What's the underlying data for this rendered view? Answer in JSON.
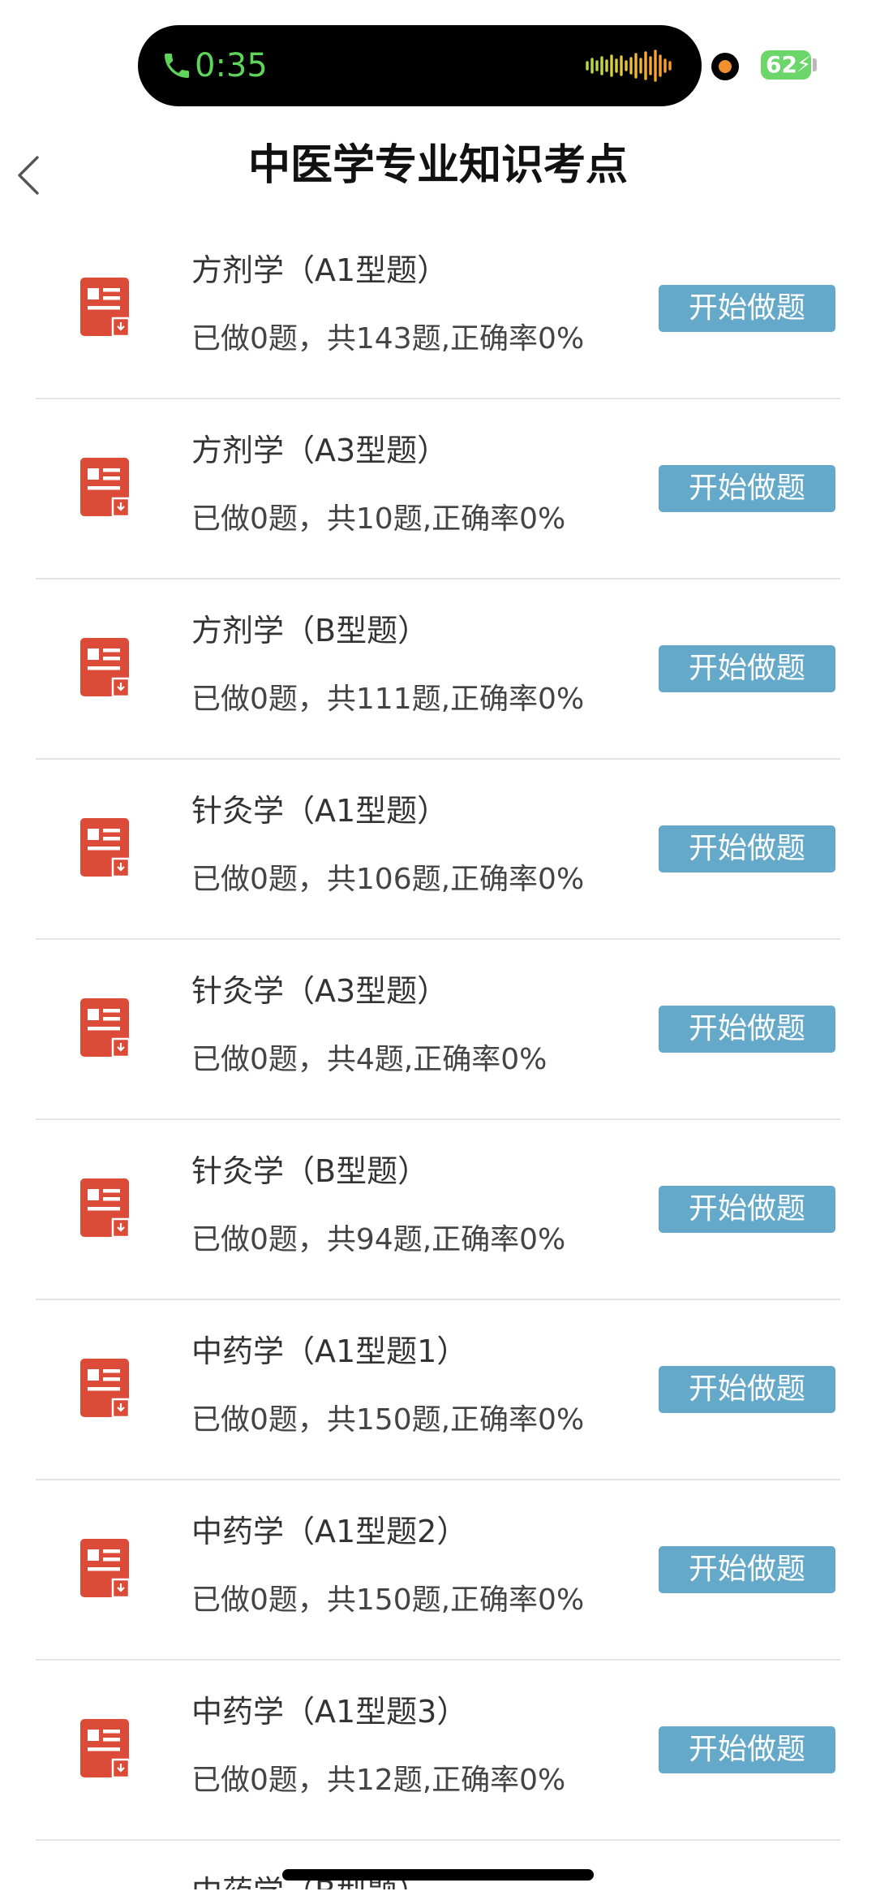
{
  "status_bar": {
    "call_time": "0:35",
    "battery_level": "62",
    "call_icon": "phone-icon",
    "waveform_icon": "audio-waveform-icon",
    "accent_green": "#5fd45a"
  },
  "nav": {
    "title": "中医学专业知识考点",
    "back_icon": "chevron-left-icon"
  },
  "list": {
    "button_label": "开始做题",
    "button_color": "#64a9c9",
    "icon_color": "#dc4a38",
    "items": [
      {
        "title": "方剂学（A1型题）",
        "stats": "已做0题，共143题,正确率0%"
      },
      {
        "title": "方剂学（A3型题）",
        "stats": "已做0题，共10题,正确率0%"
      },
      {
        "title": "方剂学（B型题）",
        "stats": "已做0题，共111题,正确率0%"
      },
      {
        "title": "针灸学（A1型题）",
        "stats": "已做0题，共106题,正确率0%"
      },
      {
        "title": "针灸学（A3型题）",
        "stats": "已做0题，共4题,正确率0%"
      },
      {
        "title": "针灸学（B型题）",
        "stats": "已做0题，共94题,正确率0%"
      },
      {
        "title": "中药学（A1型题1）",
        "stats": "已做0题，共150题,正确率0%"
      },
      {
        "title": "中药学（A1型题2）",
        "stats": "已做0题，共150题,正确率0%"
      },
      {
        "title": "中药学（A1型题3）",
        "stats": "已做0题，共12题,正确率0%"
      }
    ],
    "partial_item": {
      "title": "中药学（B型题）"
    }
  }
}
